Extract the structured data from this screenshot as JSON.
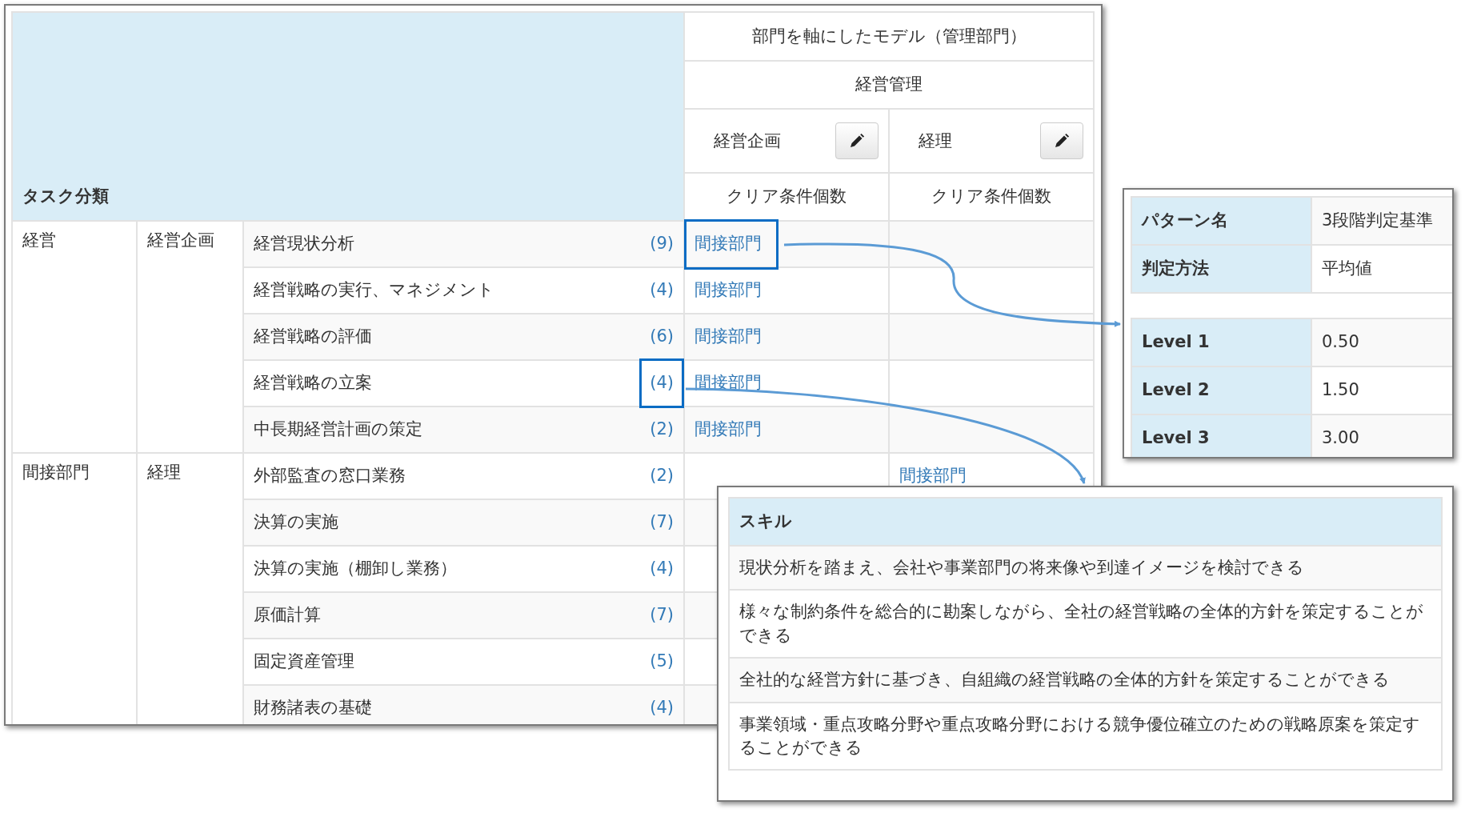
{
  "task_table": {
    "corner_label": "タスク分類",
    "model_title": "部門を軸にしたモデル（管理部門）",
    "group_title": "経営管理",
    "departments": [
      {
        "name": "経営企画",
        "count_header": "クリア条件個数"
      },
      {
        "name": "経理",
        "count_header": "クリア条件個数"
      }
    ],
    "groups": [
      {
        "category": "経営",
        "subcategory": "経営企画",
        "tasks": [
          {
            "name": "経営現状分析",
            "count": "(9)",
            "planning_cell": "間接部門",
            "count_highlighted": false,
            "link_highlighted": true
          },
          {
            "name": "経営戦略の実行、マネジメント",
            "count": "(4)",
            "planning_cell": "間接部門",
            "count_highlighted": false,
            "link_highlighted": false
          },
          {
            "name": "経営戦略の評価",
            "count": "(6)",
            "planning_cell": "間接部門",
            "count_highlighted": false,
            "link_highlighted": false
          },
          {
            "name": "経営戦略の立案",
            "count": "(4)",
            "planning_cell": "間接部門",
            "count_highlighted": true,
            "link_highlighted": false
          },
          {
            "name": "中長期経営計画の策定",
            "count": "(2)",
            "planning_cell": "間接部門",
            "count_highlighted": false,
            "link_highlighted": false
          }
        ]
      },
      {
        "category": "間接部門",
        "subcategory": "経理",
        "tasks": [
          {
            "name": "外部監査の窓口業務",
            "count": "(2)",
            "accounting_cell": "間接部門",
            "count_highlighted": false,
            "link_highlighted": false
          },
          {
            "name": "決算の実施",
            "count": "(7)",
            "count_highlighted": false,
            "link_highlighted": false
          },
          {
            "name": "決算の実施（棚卸し業務）",
            "count": "(4)",
            "count_highlighted": false,
            "link_highlighted": false
          },
          {
            "name": "原価計算",
            "count": "(7)",
            "count_highlighted": false,
            "link_highlighted": false
          },
          {
            "name": "固定資産管理",
            "count": "(5)",
            "count_highlighted": false,
            "link_highlighted": false
          },
          {
            "name": "財務諸表の基礎",
            "count": "(4)",
            "count_highlighted": false,
            "link_highlighted": false
          }
        ]
      }
    ]
  },
  "pattern_panel": {
    "rows": [
      {
        "label": "パターン名",
        "value": "3段階判定基準"
      },
      {
        "label": "判定方法",
        "value": "平均値"
      }
    ],
    "levels": [
      {
        "label": "Level 1",
        "value": "0.50"
      },
      {
        "label": "Level 2",
        "value": "1.50"
      },
      {
        "label": "Level 3",
        "value": "3.00"
      }
    ]
  },
  "skill_panel": {
    "title": "スキル",
    "items": [
      "現状分析を踏まえ、会社や事業部門の将来像や到達イメージを検討できる",
      "様々な制約条件を総合的に勘案しながら、全社の経営戦略の全体的方針を策定することができる",
      "全社的な経営方針に基づき、自組織の経営戦略の全体的方針を策定することができる",
      "事業領域・重点攻略分野や重点攻略分野における競争優位確立のための戦略原案を策定することができる"
    ]
  }
}
